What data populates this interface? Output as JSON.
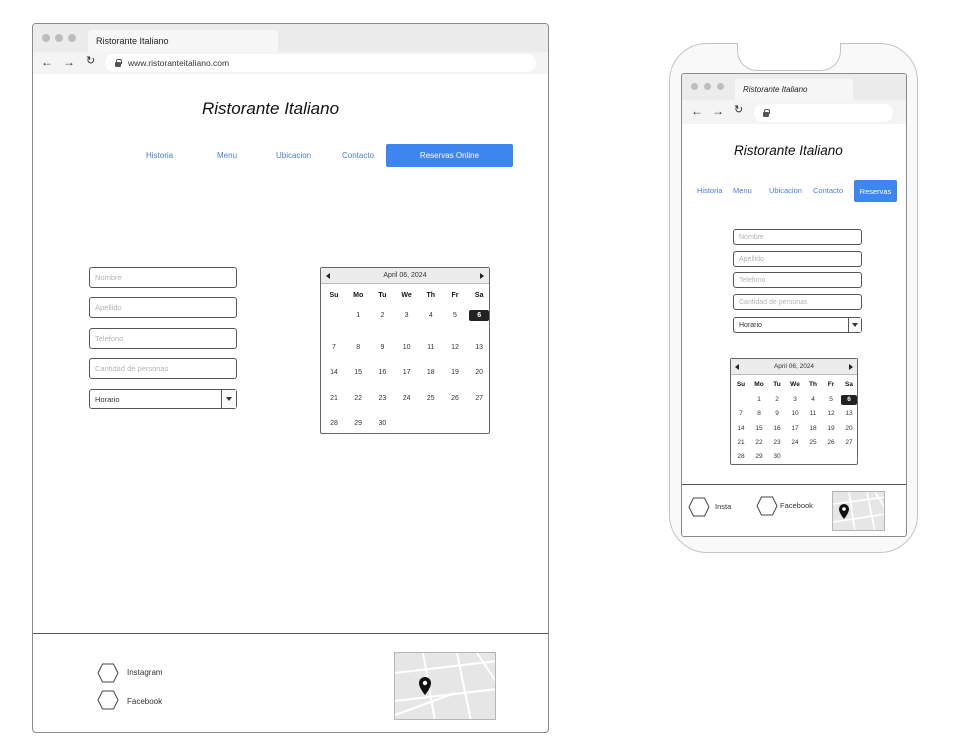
{
  "desktop": {
    "tab_title": "Ristorante Italiano",
    "url": "www.ristoranteitaliano.com",
    "site_title": "Ristorante Italiano",
    "nav": [
      "Historia",
      "Menu",
      "Ubicacion",
      "Contacto"
    ],
    "nav_cta": "Reservas Online",
    "form": {
      "nombre": "Nombre",
      "apellido": "Apellido",
      "telefono": "Telefono",
      "personas": "Cantidad de personas",
      "horario": "Horario"
    },
    "social": [
      "Instagram",
      "Facebook"
    ]
  },
  "mobile": {
    "tab_title": "Ristorante Italiano",
    "site_title": "Ristorante Italiano",
    "nav": [
      "Historia",
      "Menu",
      "Ubicacion",
      "Contacto"
    ],
    "nav_cta": "Reservas",
    "form": {
      "nombre": "Nombre",
      "apellido": "Apellido",
      "telefono": "Telefono",
      "personas": "Cantidad de personas",
      "horario": "Horario"
    },
    "social": [
      "Insta",
      "Facebook"
    ]
  },
  "calendar": {
    "month_label": "April 06, 2024",
    "weekdays": [
      "Su",
      "Mo",
      "Tu",
      "We",
      "Th",
      "Fr",
      "Sa"
    ],
    "first_weekday": 1,
    "days_in_month": 30,
    "selected_day": 6
  },
  "colors": {
    "accent": "#3d86f0",
    "link": "#4a7fd4",
    "selected_day": "#222222"
  },
  "icons": {
    "back": "arrow-left-icon",
    "forward": "arrow-right-icon",
    "reload": "reload-icon",
    "lock": "lock-icon",
    "social": "hexagon-icon",
    "map_pin": "map-pin-icon"
  }
}
